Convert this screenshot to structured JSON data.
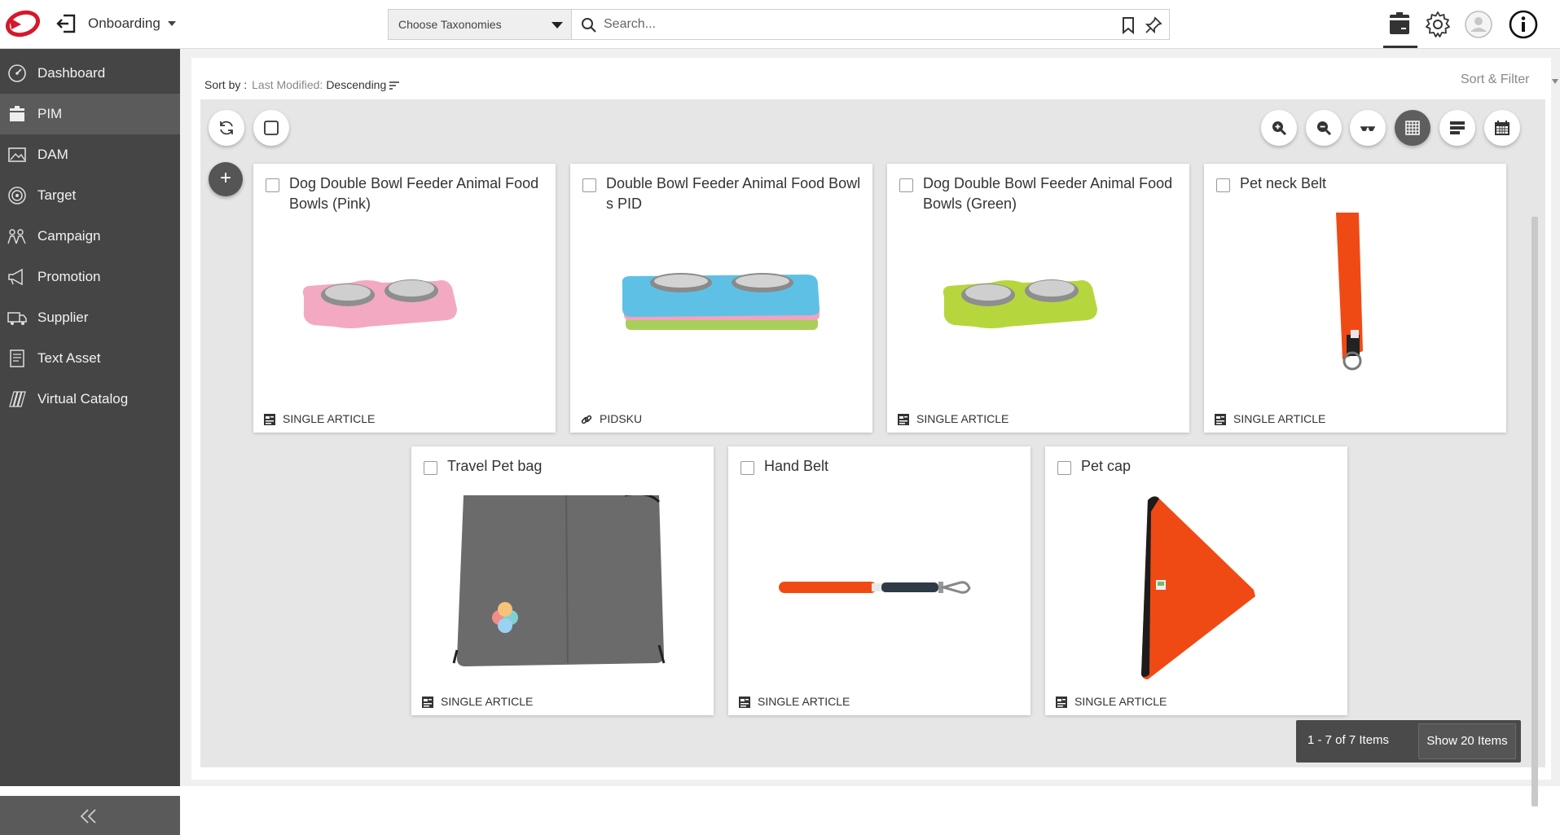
{
  "header": {
    "context_label": "Onboarding",
    "taxonomy_select": "Choose Taxonomies",
    "search_placeholder": "Search..."
  },
  "sidebar": {
    "items": [
      {
        "label": "Dashboard",
        "icon": "dashboard-icon"
      },
      {
        "label": "PIM",
        "icon": "pim-icon",
        "active": true
      },
      {
        "label": "DAM",
        "icon": "image-icon"
      },
      {
        "label": "Target",
        "icon": "target-icon"
      },
      {
        "label": "Campaign",
        "icon": "campaign-icon"
      },
      {
        "label": "Promotion",
        "icon": "megaphone-icon"
      },
      {
        "label": "Supplier",
        "icon": "truck-icon"
      },
      {
        "label": "Text Asset",
        "icon": "document-icon"
      },
      {
        "label": "Virtual Catalog",
        "icon": "catalog-icon"
      }
    ]
  },
  "toolbar": {
    "sort_label": "Sort by :",
    "sort_field": "Last Modified:",
    "sort_direction": "Descending",
    "sort_filter_label": "Sort & Filter"
  },
  "products": [
    {
      "title": "Dog Double Bowl Feeder Animal Food Bowls (Pink)",
      "type": "SINGLE ARTICLE",
      "type_icon": "article-icon"
    },
    {
      "title": "Double Bowl Feeder Animal Food Bowls PID",
      "type": "PIDSKU",
      "type_icon": "link-icon"
    },
    {
      "title": "Dog Double Bowl Feeder Animal Food Bowls (Green)",
      "type": "SINGLE ARTICLE",
      "type_icon": "article-icon"
    },
    {
      "title": "Pet neck Belt",
      "type": "SINGLE ARTICLE",
      "type_icon": "article-icon"
    },
    {
      "title": "Travel Pet bag",
      "type": "SINGLE ARTICLE",
      "type_icon": "article-icon"
    },
    {
      "title": "Hand Belt",
      "type": "SINGLE ARTICLE",
      "type_icon": "article-icon"
    },
    {
      "title": "Pet cap",
      "type": "SINGLE ARTICLE",
      "type_icon": "article-icon"
    }
  ],
  "pager": {
    "count_label": "1 - 7 of 7 Items",
    "show_label": "Show 20 Items"
  },
  "colors": {
    "sidebar_bg": "#454545",
    "sidebar_active": "#5b5b5b",
    "brand_red": "#d6182b",
    "accent_orange": "#f04a14"
  }
}
